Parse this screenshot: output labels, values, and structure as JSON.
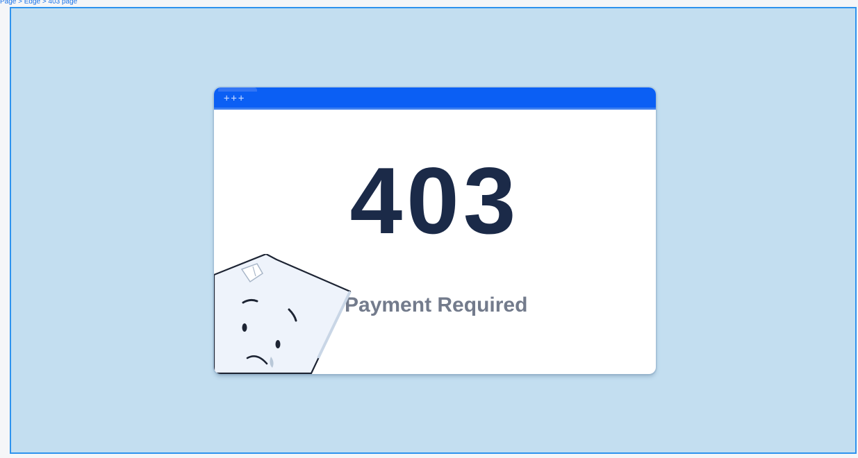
{
  "breadcrumb": {
    "text": "Page > Edge > 403 page"
  },
  "error": {
    "code": "403",
    "message": "Payment Required"
  },
  "window": {
    "controls_glyph": "+++"
  },
  "mascot": {
    "icon": "sad-paper-icon"
  },
  "colors": {
    "frame_background": "#c3def0",
    "frame_border": "#2d93ee",
    "titlebar": "#0b5ff4",
    "code_text": "#1b2a48",
    "message_text": "#737b8c"
  }
}
